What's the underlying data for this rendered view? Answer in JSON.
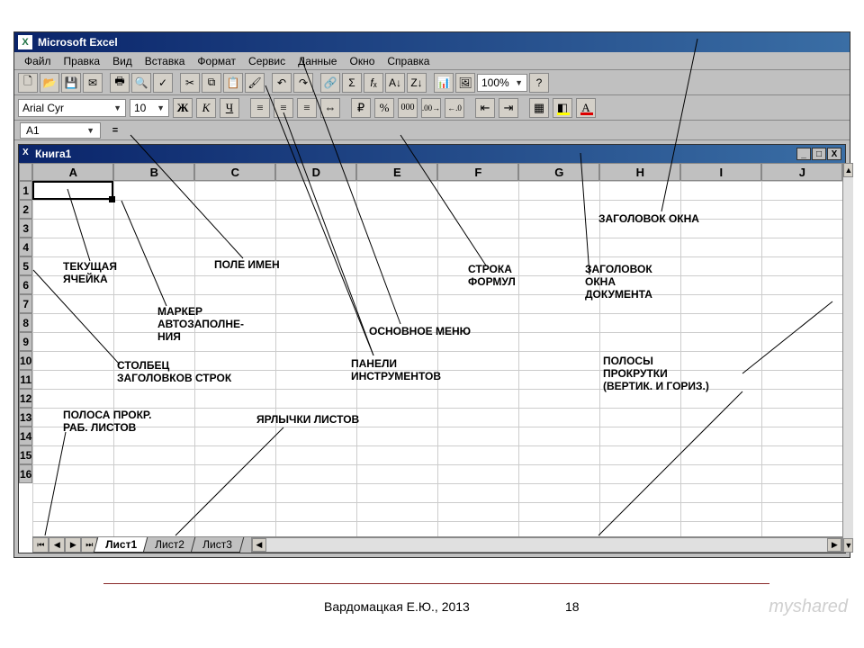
{
  "app": {
    "title": "Microsoft Excel"
  },
  "menu": {
    "file": "Файл",
    "edit": "Правка",
    "view": "Вид",
    "insert": "Вставка",
    "format": "Формат",
    "tools": "Сервис",
    "data": "Данные",
    "window": "Окно",
    "help": "Справка"
  },
  "toolbar": {
    "zoom_value": "100%",
    "font_name": "Arial Cyr",
    "font_size": "10",
    "bold_label": "Ж",
    "italic_label": "К",
    "underline_label": "Ч"
  },
  "name_box": {
    "cell_ref": "A1",
    "fx_label": "="
  },
  "workbook": {
    "title": "Книга1",
    "columns": [
      "A",
      "B",
      "C",
      "D",
      "E",
      "F",
      "G",
      "H",
      "I",
      "J"
    ],
    "rows": [
      "1",
      "2",
      "3",
      "4",
      "5",
      "6",
      "7",
      "8",
      "9",
      "10",
      "11",
      "12",
      "13",
      "14",
      "15",
      "16"
    ],
    "active_cell": "A1",
    "sheets": {
      "s1": "Лист1",
      "s2": "Лист2",
      "s3": "Лист3",
      "active": "Лист1"
    },
    "win_controls": {
      "min": "_",
      "max": "□",
      "close": "X"
    }
  },
  "annotations": {
    "window_title": "ЗАГОЛОВОК ОКНА",
    "doc_title": "ЗАГОЛОВОК\nОКНА\nДОКУМЕНТА",
    "scrollbars": "ПОЛОСЫ\nПРОКРУТКИ\n(ВЕРТИК. И ГОРИЗ.)",
    "formula_bar": "СТРОКА\nФОРМУЛ",
    "main_menu": "ОСНОВНОЕ МЕНЮ",
    "toolbars": "ПАНЕЛИ\nИНСТРУМЕНТОВ",
    "name_field": "ПОЛЕ ИМЕН",
    "active_cell_lbl": "ТЕКУЩАЯ\nЯЧЕЙКА",
    "fill_handle": "МАРКЕР\nАВТОЗАПОЛНЕ-\nНИЯ",
    "row_headers": "СТОЛБЕЦ\nЗАГОЛОВКОВ СТРОК",
    "sheet_scroll": "ПОЛОСА ПРОКР.\nРАБ. ЛИСТОВ",
    "sheet_tabs": "ЯРЛЫЧКИ ЛИСТОВ"
  },
  "footer": {
    "credit": "Вардомацкая Е.Ю., 2013",
    "page": "18",
    "watermark": "myshared"
  }
}
